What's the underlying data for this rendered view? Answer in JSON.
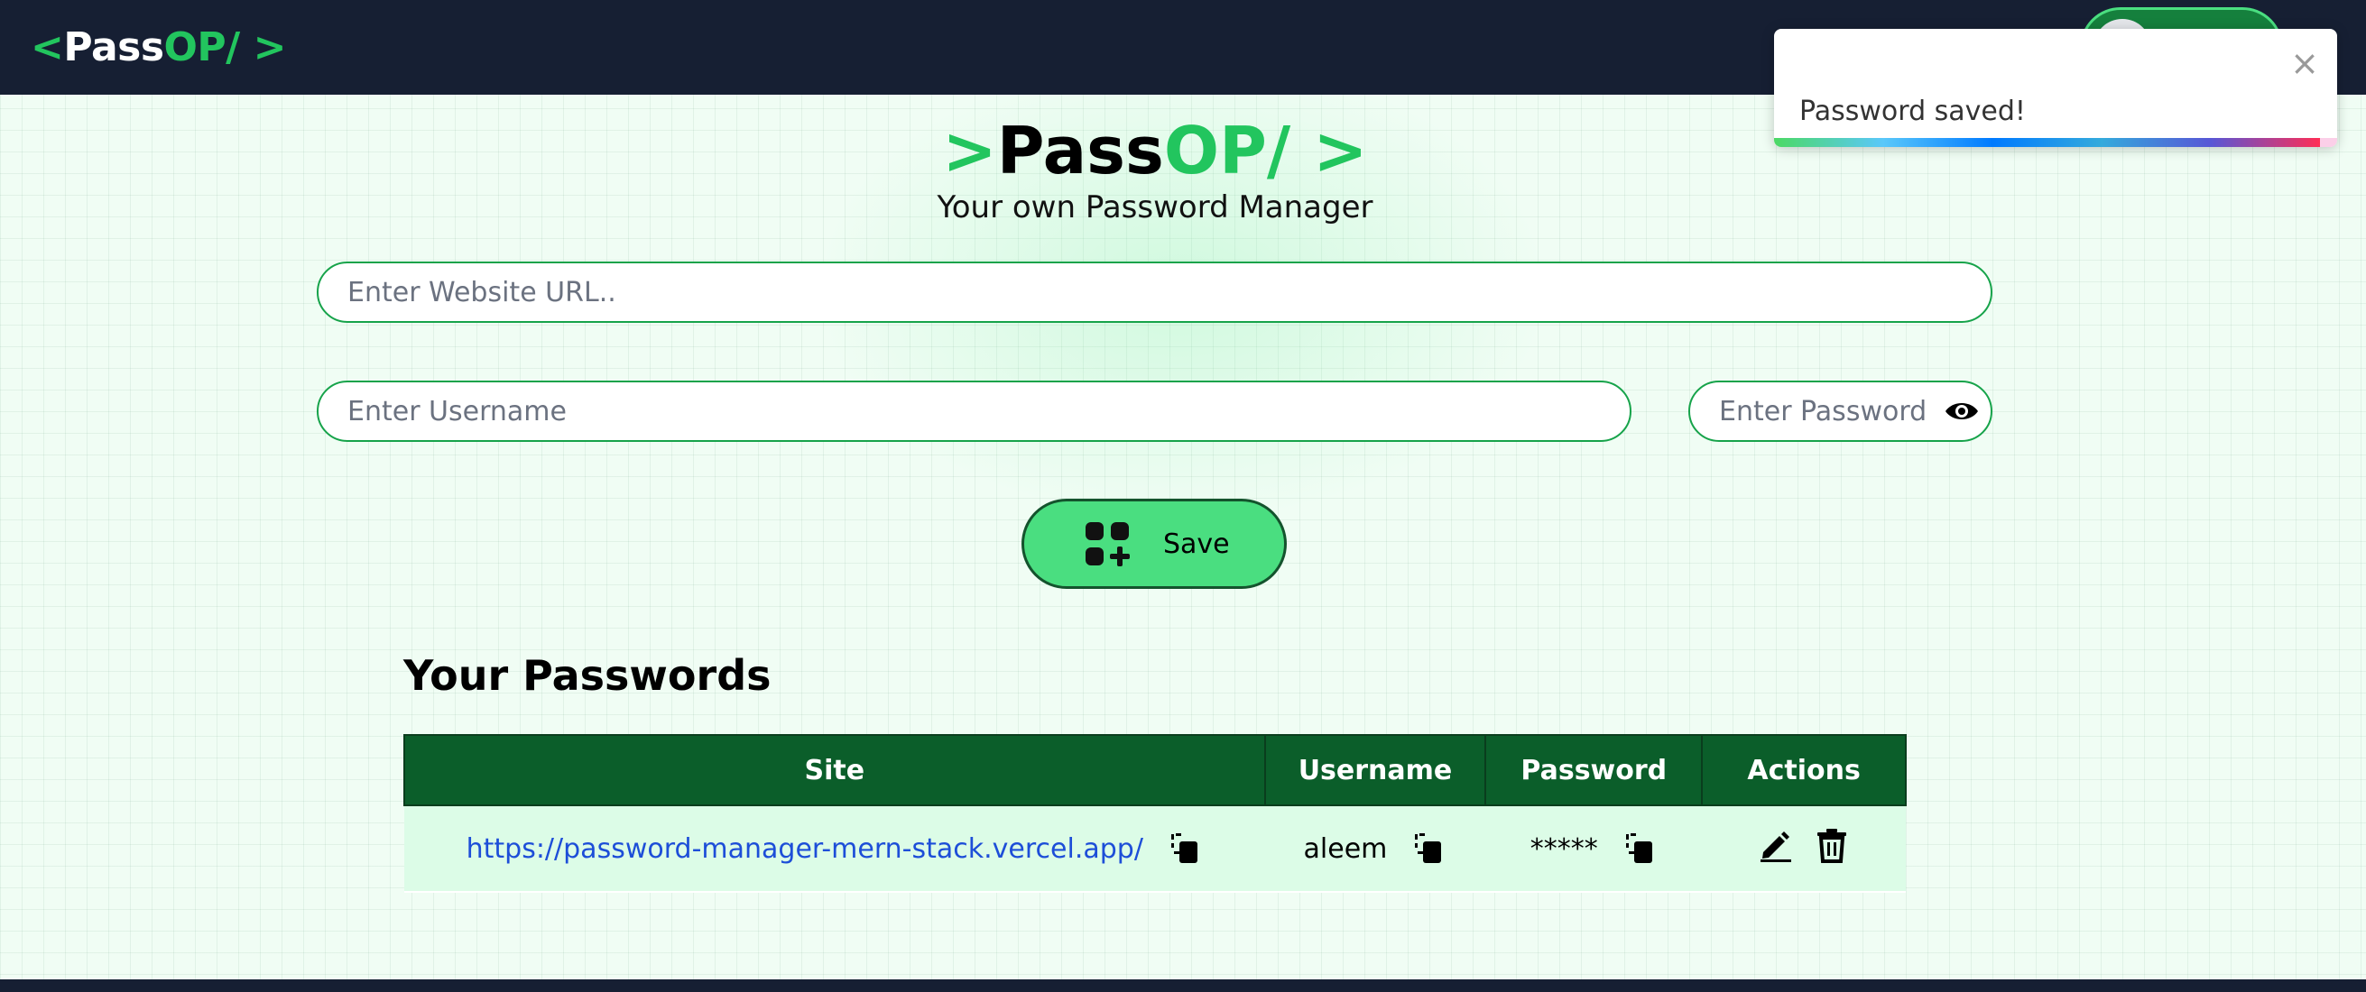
{
  "navbar": {
    "brand_lt": "<",
    "brand_pass": "Pass",
    "brand_op": "OP/",
    "brand_gt": ">"
  },
  "header": {
    "title_lt": ">",
    "title_pass": "Pass",
    "title_op": "OP/",
    "title_gt": ">",
    "subtitle": "Your own Password Manager"
  },
  "form": {
    "url_placeholder": "Enter Website URL..",
    "username_placeholder": "Enter Username",
    "password_placeholder": "Enter Password",
    "save_label": "Save"
  },
  "passwords": {
    "title": "Your Passwords",
    "columns": [
      "Site",
      "Username",
      "Password",
      "Actions"
    ],
    "rows": [
      {
        "site": "https://password-manager-mern-stack.vercel.app/",
        "username": "aleem",
        "password": "*****"
      }
    ]
  },
  "toast": {
    "message": "Password saved!",
    "close": "×",
    "progress": 0.97
  },
  "colors": {
    "accent_green": "#22c55e",
    "navbar_bg": "#161f33",
    "table_header": "#0b5e2a",
    "save_button": "#4ade80"
  },
  "icons": [
    "eye-icon",
    "add-icon",
    "copy-icon",
    "edit-icon",
    "delete-icon",
    "close-icon"
  ]
}
